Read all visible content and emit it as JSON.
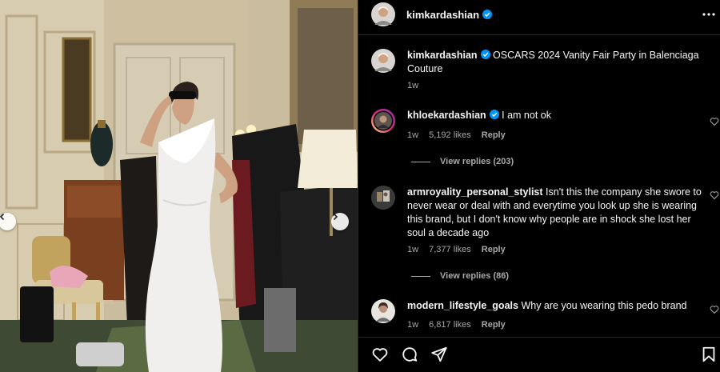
{
  "post": {
    "username": "kimkardashian",
    "caption": "OSCARS 2024 Vanity Fair Party in Balenciaga Couture",
    "time": "1w"
  },
  "comments": [
    {
      "username": "khloekardashian",
      "verified": true,
      "text": "I am not ok",
      "time": "1w",
      "likes": "5,192 likes",
      "reply": "Reply",
      "view_replies": "View replies (203)"
    },
    {
      "username": "armroyality_personal_stylist",
      "verified": false,
      "text": "Isn't this the company she swore to never wear or deal with and everytime you look up she is wearing this brand, but I don't know why people are in shock she lost her soul a decade ago",
      "time": "1w",
      "likes": "7,377 likes",
      "reply": "Reply",
      "view_replies": "View replies (86)"
    },
    {
      "username": "modern_lifestyle_goals",
      "verified": false,
      "text": "Why are you wearing this pedo brand",
      "time": "1w",
      "likes": "6,817 likes",
      "reply": "Reply"
    }
  ],
  "colors": {
    "background": "#000000",
    "text": "#f5f5f5",
    "secondary_text": "#a8a8a8",
    "verified": "#0095f6",
    "divider": "#262626"
  },
  "icons": [
    "more-options-icon",
    "verified-icon",
    "heart-icon",
    "comment-icon",
    "share-icon",
    "save-icon",
    "chevron-left-icon",
    "chevron-right-icon"
  ]
}
